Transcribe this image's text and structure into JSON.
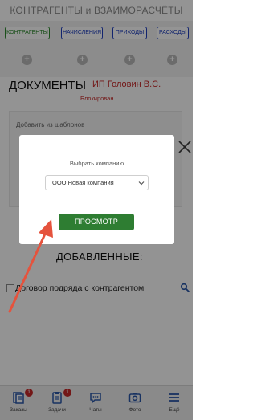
{
  "header": {
    "title": "КОНТРАГЕНТЫ и ВЗАИМОРАСЧЁТЫ"
  },
  "tabs": [
    {
      "label": "КОНТРАГЕНТЫ"
    },
    {
      "label": "НАЧИСЛЕНИЯ"
    },
    {
      "label": "ПРИХОДЫ"
    },
    {
      "label": "РАСХОДЫ"
    }
  ],
  "documents": {
    "title": "ДОКУМЕНТЫ",
    "company": "ИП Головин В.С.",
    "status": "Блокирован",
    "templates_label": "Добавить из шаблонов"
  },
  "added": {
    "title": "ДОБАВЛЕННЫЕ:",
    "items": [
      {
        "label": "Договор подряда с контрагентом"
      }
    ]
  },
  "modal": {
    "select_label": "Выбрать компанию",
    "selected_company": "ООО Новая компания",
    "view_button": "ПРОСМОТР"
  },
  "bottom_nav": [
    {
      "label": "Заказы",
      "icon": "orders-icon",
      "badge": "1"
    },
    {
      "label": "Задачи",
      "icon": "tasks-icon",
      "badge": "1"
    },
    {
      "label": "Чаты",
      "icon": "chat-icon",
      "badge": ""
    },
    {
      "label": "Фото",
      "icon": "camera-icon",
      "badge": ""
    },
    {
      "label": "Ещё",
      "icon": "menu-icon",
      "badge": ""
    }
  ],
  "colors": {
    "accent_green": "#2e7d32",
    "tab_blue": "#1f3fbf",
    "alert_red": "#c62828",
    "arrow_red": "#e5533d",
    "icon_blue": "#2a56a8"
  }
}
